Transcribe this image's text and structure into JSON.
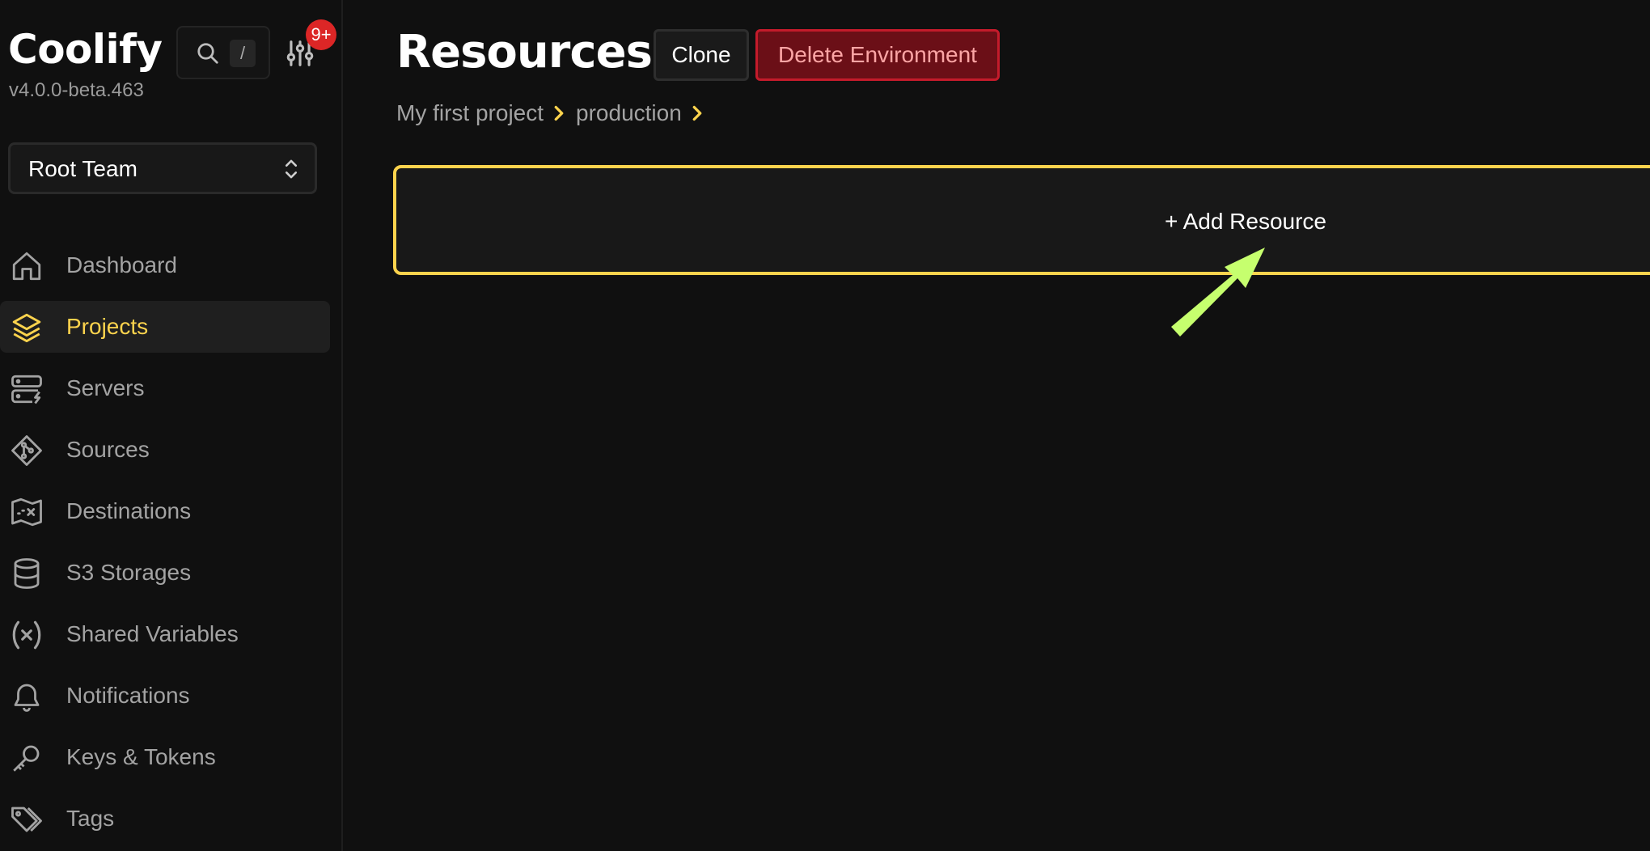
{
  "app": {
    "name": "Coolify",
    "version": "v4.0.0-beta.463",
    "search_shortcut": "/",
    "notification_count": "9+",
    "accent_color": "#fcd34d",
    "danger_color": "#dc2626"
  },
  "team": {
    "selected": "Root Team"
  },
  "sidebar": {
    "items": [
      {
        "label": "Dashboard",
        "icon": "home-icon",
        "active": false
      },
      {
        "label": "Projects",
        "icon": "layers-icon",
        "active": true
      },
      {
        "label": "Servers",
        "icon": "server-icon",
        "active": false
      },
      {
        "label": "Sources",
        "icon": "git-icon",
        "active": false
      },
      {
        "label": "Destinations",
        "icon": "map-icon",
        "active": false
      },
      {
        "label": "S3 Storages",
        "icon": "database-icon",
        "active": false
      },
      {
        "label": "Shared Variables",
        "icon": "variable-icon",
        "active": false
      },
      {
        "label": "Notifications",
        "icon": "bell-icon",
        "active": false
      },
      {
        "label": "Keys & Tokens",
        "icon": "key-icon",
        "active": false
      },
      {
        "label": "Tags",
        "icon": "tags-icon",
        "active": false
      }
    ]
  },
  "main": {
    "title": "Resources",
    "clone_label": "Clone",
    "delete_label": "Delete Environment",
    "breadcrumb": [
      "My first project",
      "production"
    ],
    "add_resource_label": "+ Add Resource"
  }
}
